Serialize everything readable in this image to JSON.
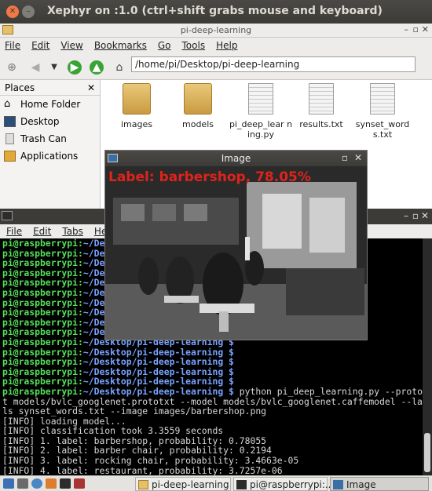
{
  "xephyr": {
    "title": "Xephyr on :1.0 (ctrl+shift grabs mouse and keyboard)"
  },
  "file_manager": {
    "title": "pi-deep-learning",
    "menu": [
      "File",
      "Edit",
      "View",
      "Bookmarks",
      "Go",
      "Tools",
      "Help"
    ],
    "path": "/home/pi/Desktop/pi-deep-learning",
    "places_header": "Places",
    "places": [
      {
        "label": "Home Folder",
        "icon": "home-icon"
      },
      {
        "label": "Desktop",
        "icon": "desktop-icon"
      },
      {
        "label": "Trash Can",
        "icon": "trash-icon"
      },
      {
        "label": "Applications",
        "icon": "applications-icon"
      }
    ],
    "files": [
      {
        "name": "images",
        "type": "folder"
      },
      {
        "name": "models",
        "type": "folder"
      },
      {
        "name": "pi_deep_lear ning.py",
        "type": "file"
      },
      {
        "name": "results.txt",
        "type": "file"
      },
      {
        "name": "synset_word s.txt",
        "type": "file"
      }
    ]
  },
  "image_window": {
    "title": "Image",
    "label": "Label: barbershop, 78.05%"
  },
  "terminal": {
    "menu": [
      "File",
      "Edit",
      "Tabs",
      "Help"
    ],
    "prompt_user": "pi@raspberrypi:",
    "lines": [
      {
        "p": "~/Desktop/pi-deep-learning $",
        "c": ""
      },
      {
        "p": "~/Desktop/pi-deep-learning $",
        "c": ""
      },
      {
        "p": "~/Desktop/pi-deep-learning $",
        "c": ""
      },
      {
        "p": "~/Desktop/pi-deep-learning $",
        "c": ""
      },
      {
        "p": "~/Desktop/pi-deep-learning $",
        "c": ""
      },
      {
        "p": "~/Desktop/pi-deep-learning $",
        "c": ""
      },
      {
        "p": "~/Desktop/pi-deep-learning $",
        "c": ""
      },
      {
        "p": "~/Desktop/pi-deep-learning $",
        "c": ""
      },
      {
        "p": "~/Desktop/pi-deep-learning $",
        "c": ""
      },
      {
        "p": "~/Desktop/pi-deep-learning $",
        "c": ""
      },
      {
        "p": "~/Desktop/pi-deep-learning $",
        "c": ""
      },
      {
        "p": "~/Desktop/pi-deep-learning $",
        "c": ""
      },
      {
        "p": "~/Desktop/pi-deep-learning $",
        "c": ""
      },
      {
        "p": "~/Desktop/pi-deep-learning $",
        "c": ""
      },
      {
        "p": "~/Desktop/pi-deep-learning $",
        "c": ""
      },
      {
        "p": "~/Desktop/pi-deep-learning $",
        "c": " python pi_deep_learning.py --prototx"
      }
    ],
    "output": [
      "t models/bvlc_googlenet.prototxt --model models/bvlc_googlenet.caffemodel --labe",
      "ls synset_words.txt --image images/barbershop.png",
      "[INFO] loading model...",
      "[INFO] classification took 3.3559 seconds",
      "[INFO] 1. label: barbershop, probability: 0.78055",
      "[INFO] 2. label: barber chair, probability: 0.2194",
      "[INFO] 3. label: rocking chair, probability: 3.4663e-05",
      "[INFO] 4. label: restaurant, probability: 3.7257e-06",
      "[INFO] 5. label: hair spray, probability: 1.4715e-06"
    ]
  },
  "taskbar": {
    "tasks": [
      "pi-deep-learning",
      "pi@raspberrypi:...",
      "Image"
    ]
  }
}
